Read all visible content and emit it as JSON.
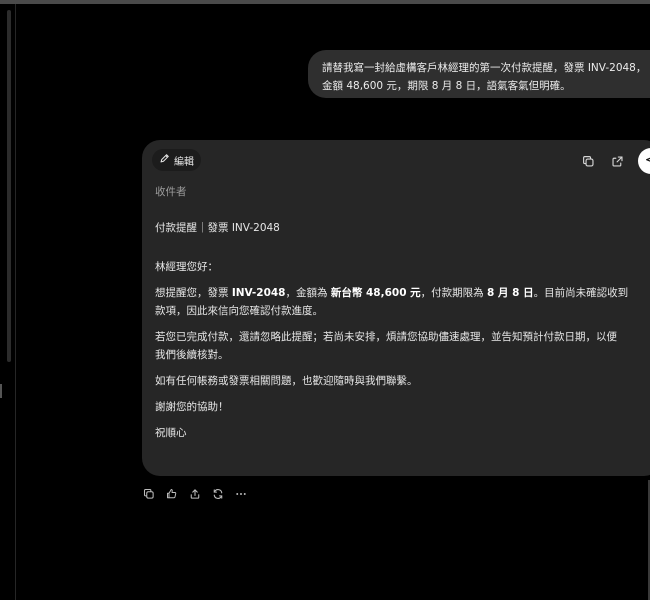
{
  "user_message": {
    "line1": "請替我寫一封給虛構客戶林經理的第一次付款提醒，發票 INV-2048，",
    "line2": "金額 48,600 元，期限 8 月 8 日，語氣客氣但明確。"
  },
  "email_card": {
    "edit_label": "編輯",
    "recipient_label": "收件者",
    "subject": "付款提醒｜發票 INV-2048",
    "greeting": "林經理您好：",
    "p1_a": "想提醒您，發票 ",
    "p1_invoice": "INV-2048",
    "p1_b": "，金額為 ",
    "p1_amount": "新台幣 48,600 元",
    "p1_c": "，付款期限為 ",
    "p1_date": "8 月 8 日",
    "p1_d": "。目前尚未確認收到",
    "p1_line2": "款項，因此來信向您確認付款進度。",
    "p2_line1": "若您已完成付款，還請忽略此提醒；若尚未安排，煩請您協助儘速處理，並告知預計付款日期，以便",
    "p2_line2": "我們後續核對。",
    "p3": "如有任何帳務或發票相關問題，也歡迎隨時與我們聯繫。",
    "p4": "謝謝您的協助！",
    "closing": "祝順心"
  },
  "icons": {
    "edit": "pencil-icon",
    "copy": "copy-icon",
    "open": "external-link-icon",
    "send": "send-icon",
    "msg_actions": [
      "copy-icon",
      "thumbs-icon",
      "share-icon",
      "regenerate-icon",
      "more-icon"
    ]
  }
}
